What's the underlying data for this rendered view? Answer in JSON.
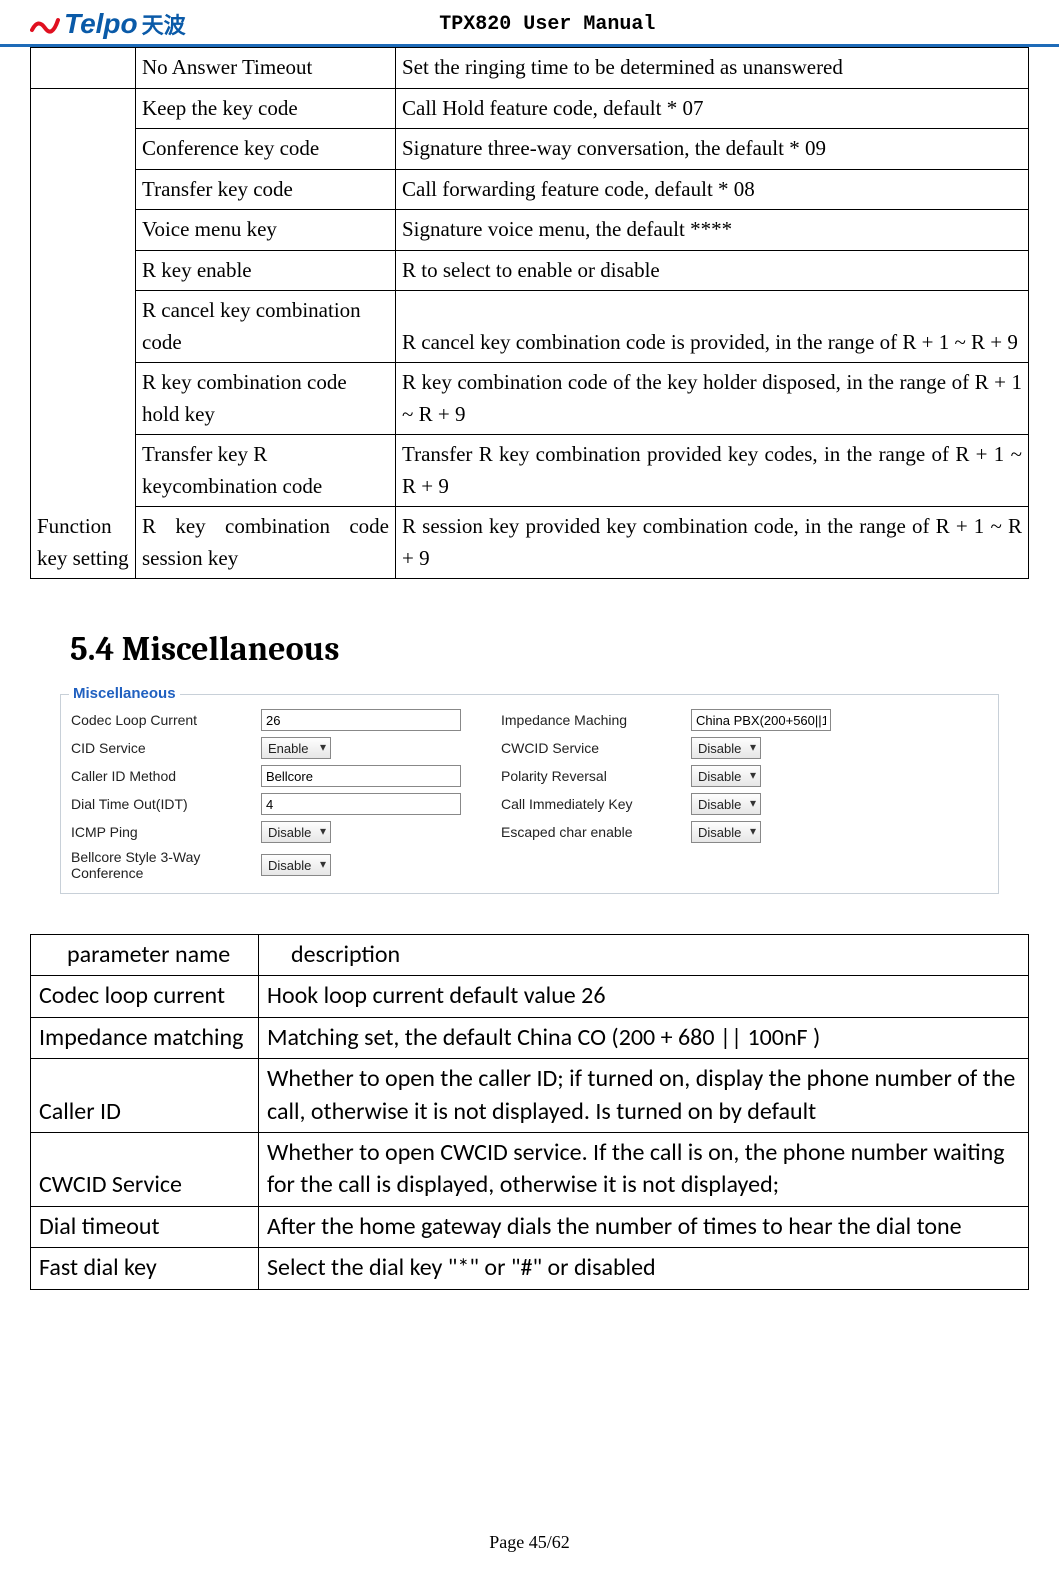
{
  "header": {
    "logo_brand": "Telpo",
    "logo_cn": "天波",
    "manual_title": "TPX820 User Manual"
  },
  "table1": {
    "r0": {
      "a": "",
      "b": "No Answer Timeout",
      "c": "Set the ringing time to be determined as unanswered"
    },
    "group_label": "Function key setting",
    "rows": {
      "r1": {
        "b": "Keep the key code",
        "c": "Call Hold feature code, default * 07"
      },
      "r2": {
        "b": "Conference key code",
        "c": "Signature three-way conversation, the default * 09"
      },
      "r3": {
        "b": "Transfer key code",
        "c": "Call forwarding feature code, default * 08"
      },
      "r4": {
        "b": "Voice menu key",
        "c": "Signature voice menu, the default ****"
      },
      "r5": {
        "b": "R key enable",
        "c": "R to select to enable or disable"
      },
      "r6": {
        "b": "R cancel key combination code",
        "c": "R cancel key combination code is provided, in the range of R + 1 ~ R + 9"
      },
      "r7": {
        "b": "R key combination code hold key",
        "c": "R key combination code of the key holder disposed, in the range of R + 1 ~ R + 9"
      },
      "r8": {
        "b": "Transfer key R keycombination code",
        "c": "Transfer R key combination  provided  key  codes,  in  the  range of R + 1 ~ R + 9"
      },
      "r9": {
        "b": "R key  combination  code  session key",
        "c": "R session key provided key combination code, in the range of R + 1 ~ R + 9"
      }
    }
  },
  "section_title": "5.4 Miscellaneous",
  "misc": {
    "legend": "Miscellaneous",
    "labels": {
      "codec": "Codec Loop Current",
      "impedance": "Impedance Maching",
      "cid": "CID Service",
      "cwcid": "CWCID Service",
      "cidmethod": "Caller ID Method",
      "polarity": "Polarity Reversal",
      "dialtimeout": "Dial Time Out(IDT)",
      "callimm": "Call Immediately Key",
      "icmp": "ICMP Ping",
      "escaped": "Escaped char enable",
      "bellcore": "Bellcore Style 3-Way Conference"
    },
    "values": {
      "codec": "26",
      "impedance": "China PBX(200+560||1",
      "cid": "Enable",
      "cwcid": "Disable",
      "cidmethod": "Bellcore",
      "polarity": "Disable",
      "dialtimeout": "4",
      "callimm": "Disable",
      "icmp": "Disable",
      "escaped": "Disable",
      "bellcore": "Disable"
    }
  },
  "table2": {
    "header": {
      "a": "parameter name",
      "b": "description"
    },
    "rows": {
      "r1": {
        "a": "Codec loop current",
        "b": "Hook loop current default value 26"
      },
      "r2": {
        "a": "Impedance matching",
        "b": "Matching set, the default China CO (200 + 680 || 100nF )"
      },
      "r3": {
        "a": "Caller ID",
        "b": "Whether to open the caller ID; if turned on, display the phone number of the call, otherwise it is not displayed. Is turned on by default"
      },
      "r4": {
        "a": "CWCID Service",
        "b": "Whether to open CWCID service. If the call is on, the phone number waiting for the call is displayed, otherwise it is not displayed;"
      },
      "r5": {
        "a": "Dial timeout",
        "b": "After the home gateway dials the number of times to hear the dial tone"
      },
      "r6": {
        "a": "Fast dial key",
        "b": "Select the dial key \"*\" or \"#\" or disabled"
      }
    }
  },
  "footer": "Page 45/62"
}
